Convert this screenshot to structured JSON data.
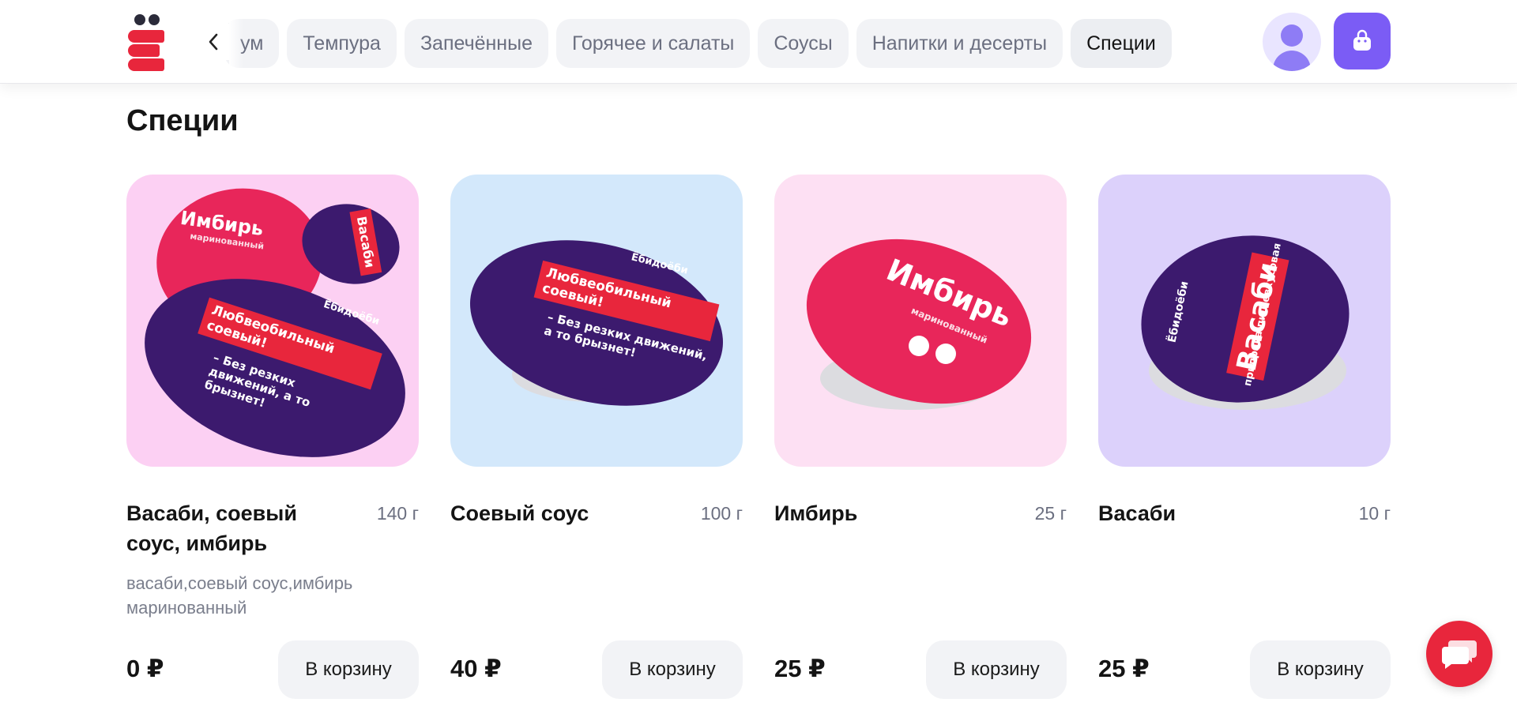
{
  "header": {
    "tabs": [
      {
        "label": "ум",
        "active": false
      },
      {
        "label": "Темпура",
        "active": false
      },
      {
        "label": "Запечённые",
        "active": false
      },
      {
        "label": "Горячее и салаты",
        "active": false
      },
      {
        "label": "Соусы",
        "active": false
      },
      {
        "label": "Напитки и десерты",
        "active": false
      },
      {
        "label": "Специи",
        "active": true
      }
    ],
    "icons": {
      "back": "chevron-left-icon",
      "profile": "user-icon",
      "cart": "shopping-bag-icon"
    }
  },
  "section": {
    "title": "Специи"
  },
  "products": [
    {
      "name": "Васаби, соевый соус, имбирь",
      "weight": "140 г",
      "description": "васаби,соевый соус,имбирь маринованный",
      "price": "0 ₽",
      "button": "В корзину",
      "bg": "#fcd0f3",
      "art": {
        "lid1": "Имбирь",
        "lid1_sub": "маринованный",
        "lid2": "Васаби",
        "lid3_strip": "Любвеобильный соевый!",
        "lid3_text": "– Без резких движений, а то брызнет!",
        "brand": "Ёбидоёби"
      }
    },
    {
      "name": "Соевый соус",
      "weight": "100 г",
      "description": "",
      "price": "40 ₽",
      "button": "В корзину",
      "bg": "#d3e8fb",
      "art": {
        "strip": "Любвеобильный соевый!",
        "text": "– Без резких движений, а то брызнет!",
        "brand": "Ёбидоёби"
      }
    },
    {
      "name": "Имбирь",
      "weight": "25 г",
      "description": "",
      "price": "25 ₽",
      "button": "В корзину",
      "bg": "#fde0f3",
      "art": {
        "title": "Имбирь",
        "sub": "маринованный"
      }
    },
    {
      "name": "Васаби",
      "weight": "10 г",
      "description": "",
      "price": "25 ₽",
      "button": "В корзину",
      "bg": "#dcd1fb",
      "art": {
        "strip": "Васаби",
        "sub": "приправа пищевкусовая",
        "brand": "Ёбидоёби"
      }
    }
  ],
  "chat": {
    "icon": "chat-icon"
  },
  "colors": {
    "brand_red": "#e8263c",
    "accent_purple": "#7b5cf5",
    "lid_purple": "#3c1a6e"
  }
}
